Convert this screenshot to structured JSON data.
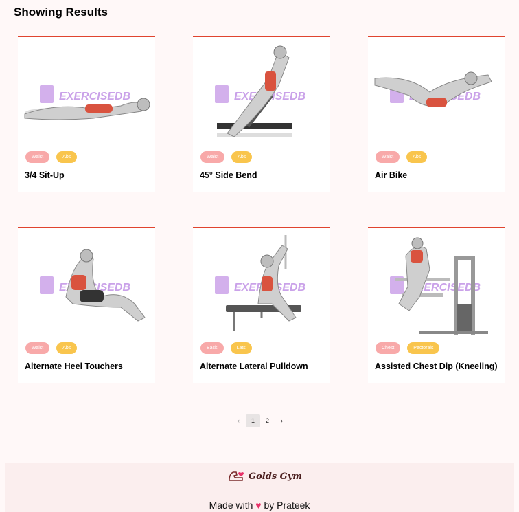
{
  "page": {
    "heading": "Showing Results"
  },
  "watermark": "EXERCISEDB",
  "cards": [
    {
      "tags": [
        "Waist",
        "Abs"
      ],
      "title": "3/4 Sit-Up",
      "figure": "situp-illustration"
    },
    {
      "tags": [
        "Waist",
        "Abs"
      ],
      "title": "45° Side Bend",
      "figure": "side-bend-illustration"
    },
    {
      "tags": [
        "Waist",
        "Abs"
      ],
      "title": "Air Bike",
      "figure": "air-bike-illustration"
    },
    {
      "tags": [
        "Waist",
        "Abs"
      ],
      "title": "Alternate Heel Touchers",
      "figure": "heel-touchers-illustration"
    },
    {
      "tags": [
        "Back",
        "Lats"
      ],
      "title": "Alternate Lateral Pulldown",
      "figure": "lateral-pulldown-illustration"
    },
    {
      "tags": [
        "Chest",
        "Pectorals"
      ],
      "title": "Assisted Chest Dip (Kneeling)",
      "figure": "chest-dip-illustration"
    }
  ],
  "pagination": {
    "prev": "‹",
    "pages": [
      "1",
      "2"
    ],
    "current": "1",
    "next": "›"
  },
  "footer": {
    "brand": "Golds Gym",
    "made_prefix": "Made with",
    "heart": "♥",
    "made_suffix": "by Prateek"
  },
  "colors": {
    "accent": "#e0442f",
    "badge_primary": "#f8a9a9",
    "badge_secondary": "#f9c54d",
    "background": "#fff8f8"
  }
}
